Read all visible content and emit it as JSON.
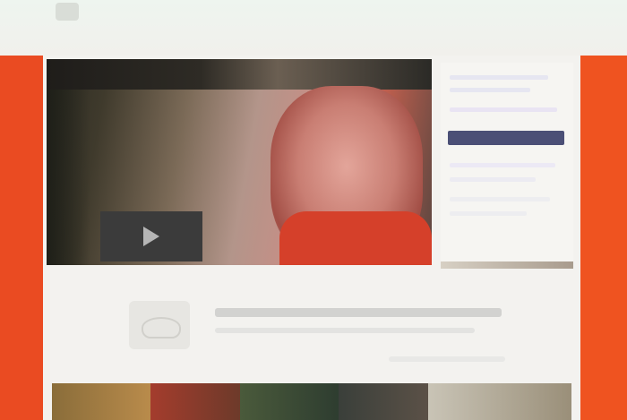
{
  "page": {
    "accent": "#ea4b22",
    "background": "#f1f0ec"
  },
  "topbar": {
    "logo_icon": "site-logo-icon"
  },
  "hero": {
    "play_icon": "play-icon"
  },
  "sidebar": {
    "button_color": "#4b4f76"
  },
  "thumbnails": [
    {
      "color": "linear-gradient(90deg,#8a6d3a,#b98b4b)"
    },
    {
      "color": "linear-gradient(90deg,#a43c2d,#6d3a2a)"
    },
    {
      "color": "linear-gradient(90deg,#4a5a3b,#2e3d30)"
    },
    {
      "color": "linear-gradient(90deg,#3a3f3a,#5b5147)"
    },
    {
      "color": "linear-gradient(90deg,#c9c4b6,#9a8f79)"
    }
  ]
}
